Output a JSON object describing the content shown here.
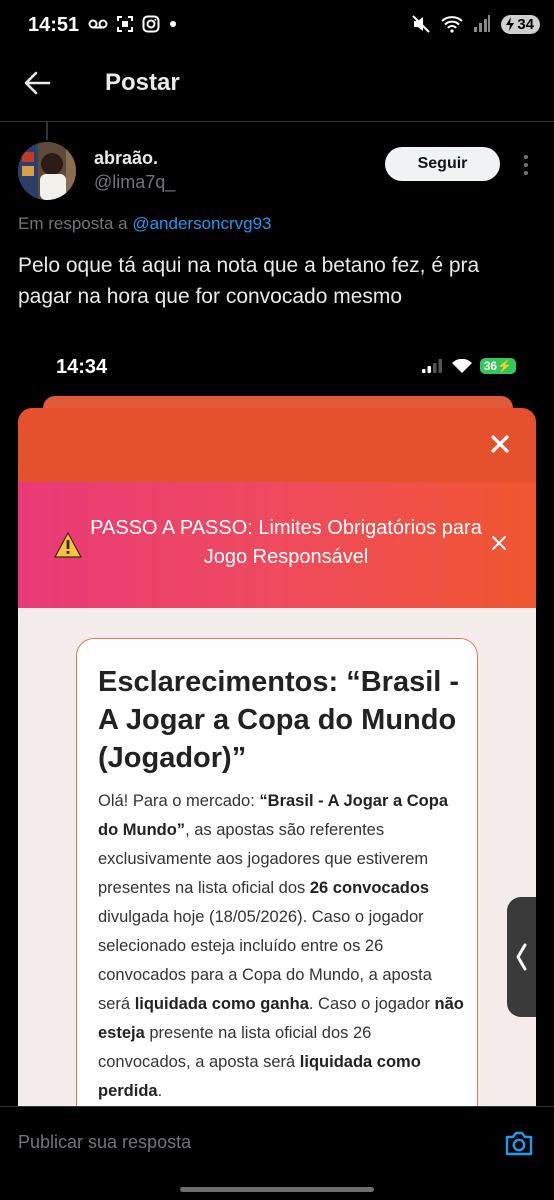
{
  "status_bar": {
    "time": "14:51",
    "battery": "34",
    "left_icons": [
      "voicemail-icon",
      "screenshot-icon",
      "instagram-icon",
      "dot-icon"
    ],
    "right_icons": [
      "mute-icon",
      "wifi-icon",
      "signal-icon",
      "battery-icon"
    ]
  },
  "header": {
    "title": "Postar",
    "back_icon": "arrow-left-icon"
  },
  "post": {
    "author_name": "abraão.",
    "author_handle": "@lima7q_",
    "follow_label": "Seguir",
    "reply_prefix": "Em resposta a",
    "reply_to": "@andersoncrvg93",
    "text": "Pelo oque tá aqui na nota que a betano fez, é pra pagar na hora que for convocado mesmo"
  },
  "media": {
    "status_time": "14:34",
    "battery": "36",
    "banner_text": "PASSO A PASSO: Limites Obrigatórios para Jogo Responsável",
    "heading": "Esclarecimentos: “Brasil - A Jogar a Copa do Mundo (Jogador)”",
    "para_parts": [
      "Olá! Para o mercado: ",
      "“Brasil - A Jogar a Copa do Mundo”",
      ", as apostas são referentes exclusivamente aos jogadores que estiverem presentes na lista oficial dos ",
      "26 convocados",
      " divulgada hoje (18/05/2026). Caso o jogador selecionado esteja incluído entre os 26 convocados para a Copa do Mundo, a aposta será ",
      "liquidada como ganha",
      ". Caso o jogador ",
      "não esteja",
      " presente na lista oficial dos 26 convocados, a aposta será ",
      "liquidada como perdida",
      "."
    ],
    "colors": {
      "orange": "#e5502e",
      "pink": "#e93a78",
      "battery_green": "#34c759"
    }
  },
  "composer": {
    "placeholder": "Publicar sua resposta",
    "camera_icon": "camera-icon"
  },
  "colors": {
    "link": "#1d9bf0",
    "muted": "#71767b",
    "text": "#e7e9ea"
  }
}
